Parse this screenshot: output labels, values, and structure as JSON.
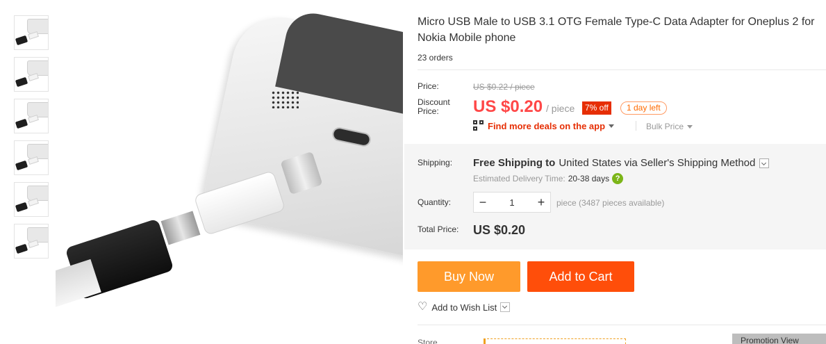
{
  "product": {
    "title_line1": "Micro USB Male to USB 3.1 OTG Female Type-C Data Adapter for Oneplus 2 for",
    "title_line2": "Nokia Mobile phone",
    "orders": "23 orders"
  },
  "price": {
    "price_label": "Price:",
    "original": "US $0.22 / piece",
    "discount_label_1": "Discount",
    "discount_label_2": "Price:",
    "current": "US $0.20",
    "unit": "/ piece",
    "off_badge": "7% off",
    "days_left": "1 day left",
    "deals_link": "Find more deals on the app",
    "bulk_price": "Bulk Price"
  },
  "shipping": {
    "label": "Shipping:",
    "free_text": "Free Shipping to",
    "destination": "United States via Seller's Shipping Method",
    "delivery_label": "Estimated Delivery Time:",
    "delivery_days": "20-38 days"
  },
  "quantity": {
    "label": "Quantity:",
    "minus": "−",
    "value": "1",
    "plus": "+",
    "available": "piece (3487 pieces available)"
  },
  "total": {
    "label": "Total Price:",
    "value": "US $0.20"
  },
  "actions": {
    "buy_now": "Buy Now",
    "add_to_cart": "Add to Cart",
    "wish_list": "Add to Wish List"
  },
  "store": {
    "label": "Store",
    "view_button": "Promotion View"
  },
  "colors": {
    "price_red": "#ff4747",
    "buy_orange": "#ff9a2b",
    "cart_red": "#ff4e0a",
    "badge_red": "#e62e04",
    "help_green": "#7cb518"
  },
  "thumbnails": [
    {
      "alt": "thumb-1"
    },
    {
      "alt": "thumb-2"
    },
    {
      "alt": "thumb-3"
    },
    {
      "alt": "thumb-4"
    },
    {
      "alt": "thumb-5"
    },
    {
      "alt": "thumb-6"
    }
  ]
}
